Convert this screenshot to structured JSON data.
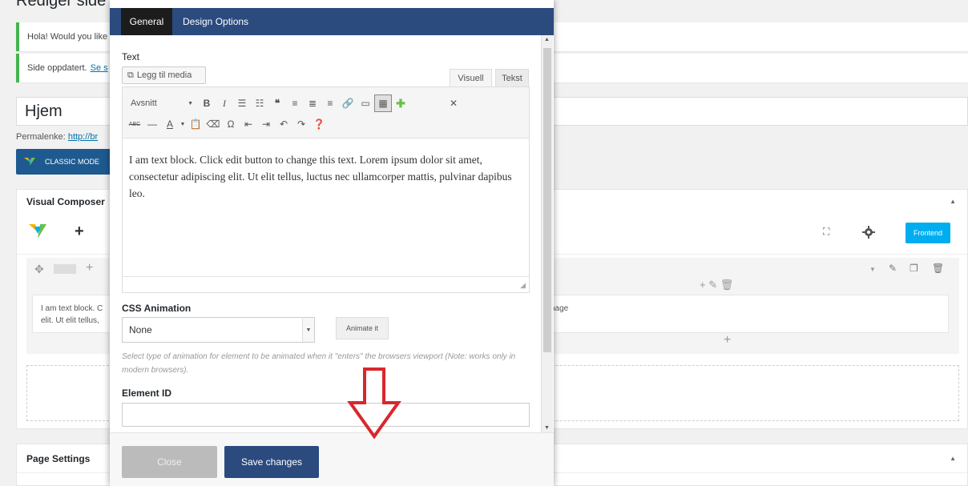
{
  "page": {
    "title": "Rediger side",
    "notices": [
      {
        "text": "Hola! Would you like"
      },
      {
        "text": "Side oppdatert.",
        "link": "Se s"
      }
    ],
    "post_title": "Hjem",
    "permalink_label": "Permalenke:",
    "permalink_link": "http://br",
    "classic_mode": "CLASSIC MODE"
  },
  "vc": {
    "box_title": "Visual Composer",
    "frontend": "Frontend",
    "element_text_line1": "I am text block. C",
    "element_text_line2": "elit. Ut elit tellus,",
    "element_right_text": "nage"
  },
  "page_settings": {
    "title": "Page Settings"
  },
  "modal": {
    "tabs": [
      "General",
      "Design Options"
    ],
    "text_label": "Text",
    "add_media": "Legg til media",
    "editor_tab_visual": "Visuell",
    "editor_tab_text": "Tekst",
    "format_select": "Avsnitt",
    "content": "I am text block. Click edit button to change this text. Lorem ipsum dolor sit amet, consectetur adipiscing elit. Ut elit tellus, luctus nec ullamcorper mattis, pulvinar dapibus leo.",
    "css_animation_label": "CSS Animation",
    "css_animation_value": "None",
    "animate_button": "Animate it",
    "help_text": "Select type of animation for element to be animated when it \"enters\" the browsers viewport (Note: works only in modern browsers).",
    "element_id_label": "Element ID",
    "element_id_value": "",
    "close_button": "Close",
    "save_button": "Save changes"
  },
  "colors": {
    "accent": "#2b4b7f",
    "frontend": "#00aef0",
    "notice_border": "#46b450",
    "arrow": "#d9272e"
  }
}
